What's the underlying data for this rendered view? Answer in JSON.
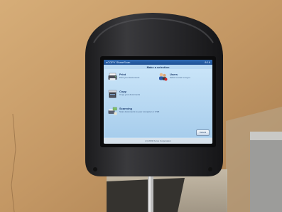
{
  "kiosk": {
    "title_bar": {
      "app_name": "eCOPY ShareScan",
      "clock": "8:16"
    },
    "heading": "Make a selection",
    "options": [
      {
        "label": "Print",
        "description": "Print your documents",
        "icon": "printer-icon"
      },
      {
        "label": "Copy",
        "description": "Copy your documents",
        "icon": "copier-icon"
      },
      {
        "label": "Scanning",
        "description": "Scan documents to your computer or USB",
        "icon": "scanner-icon"
      },
      {
        "label": "Users",
        "description": "Select a user to log in",
        "icon": "users-icon"
      }
    ],
    "cancel_label": "Cancel",
    "footer": "(c) 2009 Xerox Corporation"
  },
  "colors": {
    "title_bar": "#2a62ab",
    "screen_background": "#b9d9f2",
    "kiosk_housing": "#2a2a2c",
    "wall": "#c89c66"
  }
}
